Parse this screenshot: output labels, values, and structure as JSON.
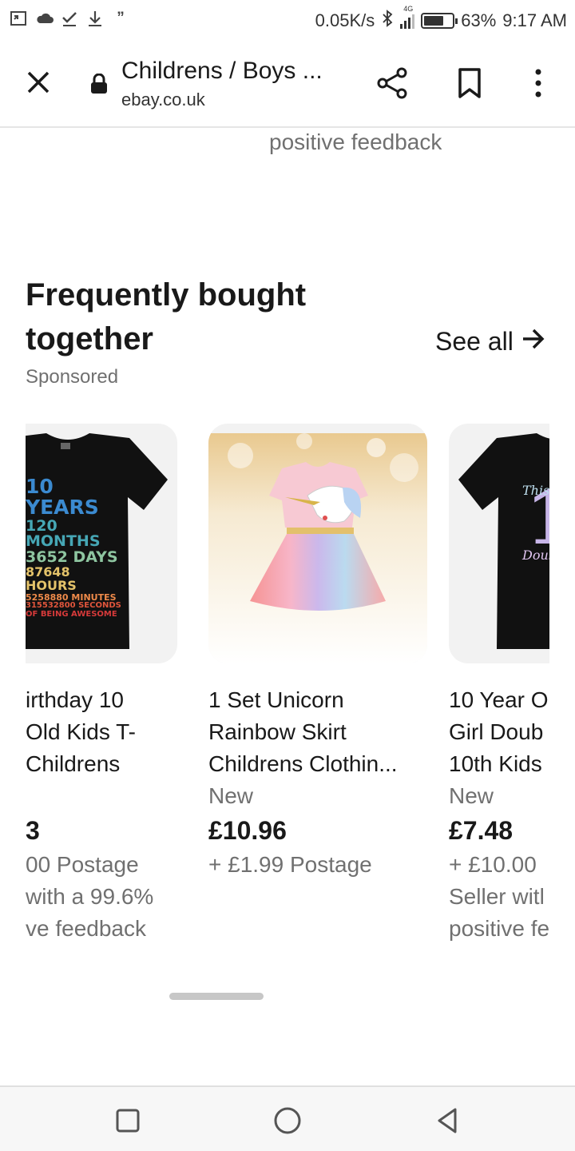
{
  "status_bar": {
    "net_speed": "0.05K/s",
    "network": "4G",
    "battery": "63%",
    "time": "9:17 AM",
    "icons": [
      "screenshot-icon",
      "cloud-icon",
      "check-icon",
      "download-icon",
      "quote-icon",
      "bluetooth-icon",
      "signal-icon",
      "battery-icon"
    ]
  },
  "toolbar": {
    "title": "Childrens / Boys ...",
    "url": "ebay.co.uk"
  },
  "prev_section": {
    "feedback_text": "positive feedback"
  },
  "section": {
    "title": "Frequently bought together",
    "sponsored": "Sponsored",
    "see_all": "See all"
  },
  "items": [
    {
      "title_lines": [
        "irthday 10",
        "Old Kids T-",
        "Childrens"
      ],
      "price_fragment": "3",
      "shipping": "00 Postage",
      "seller_lines": [
        "with a 99.6%",
        "ve feedback"
      ],
      "print_lines": [
        "10 YEARS",
        "120 MONTHS",
        "3652 DAYS",
        "87648 HOURS",
        "5258880 MINUTES",
        "315532800 SECONDS",
        "OF BEING AWESOME"
      ]
    },
    {
      "title_lines": [
        "1 Set Unicorn",
        "Rainbow Skirt",
        "Childrens Clothin..."
      ],
      "condition": "New",
      "price": "£10.96",
      "shipping": "+ £1.99 Postage"
    },
    {
      "title_lines": [
        "10 Year O",
        "Girl Doub",
        "10th Kids"
      ],
      "condition": "New",
      "price": "£7.48",
      "shipping": "+ £10.00",
      "seller_lines": [
        "Seller witl",
        "positive fe"
      ],
      "print_lines": [
        "This E",
        "Doub"
      ]
    }
  ]
}
